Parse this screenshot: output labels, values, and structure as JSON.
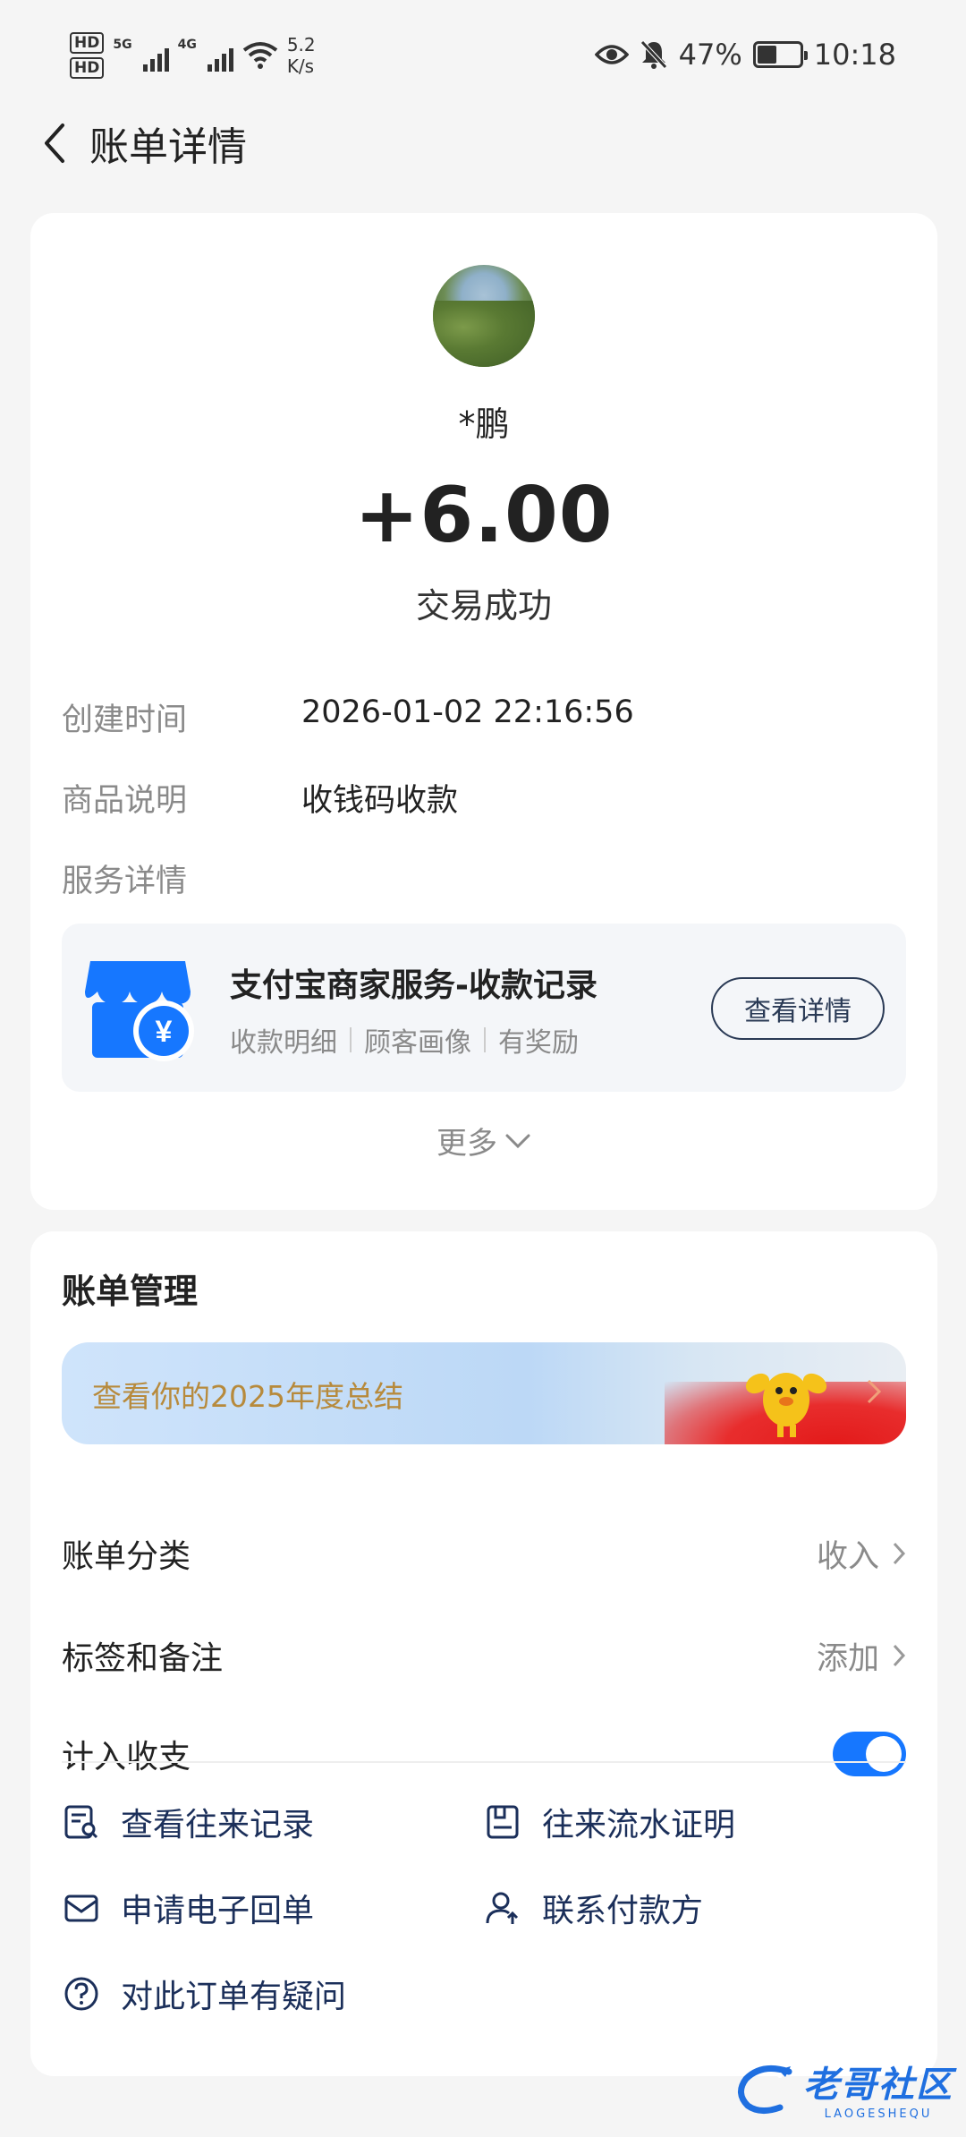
{
  "status_bar": {
    "hd1": "HD",
    "hd2": "HD",
    "net1": "5G",
    "net2": "4G",
    "speed_value": "5.2",
    "speed_unit": "K/s",
    "battery": "47%",
    "time": "10:18"
  },
  "header": {
    "title": "账单详情"
  },
  "transaction": {
    "name": "*鹏",
    "amount": "+6.00",
    "status": "交易成功"
  },
  "details": [
    {
      "label": "创建时间",
      "value": "2026-01-02 22:16:56"
    },
    {
      "label": "商品说明",
      "value": "收钱码收款"
    },
    {
      "label": "服务详情",
      "value": ""
    }
  ],
  "service": {
    "title": "支付宝商家服务-收款记录",
    "tags": [
      "收款明细",
      "顾客画像",
      "有奖励"
    ],
    "button": "查看详情",
    "icon_glyph": "¥"
  },
  "more_label": "更多",
  "management": {
    "title": "账单管理",
    "banner_text": "查看你的2025年度总结",
    "rows": [
      {
        "label": "账单分类",
        "value": "收入"
      },
      {
        "label": "标签和备注",
        "value": "添加"
      }
    ],
    "toggle_label": "计入收支",
    "toggle_on": true
  },
  "actions": [
    {
      "label": "查看往来记录",
      "icon": "record-search-icon"
    },
    {
      "label": "往来流水证明",
      "icon": "statement-proof-icon"
    },
    {
      "label": "申请电子回单",
      "icon": "envelope-icon"
    },
    {
      "label": "联系付款方",
      "icon": "contact-person-icon"
    },
    {
      "label": "对此订单有疑问",
      "icon": "question-icon"
    }
  ],
  "watermark": {
    "main": "老哥社区",
    "sub": "LAOGESHEQU"
  },
  "colors": {
    "accent": "#1677ff",
    "action_text": "#1b2f5a",
    "banner_text": "#b78a3c"
  }
}
